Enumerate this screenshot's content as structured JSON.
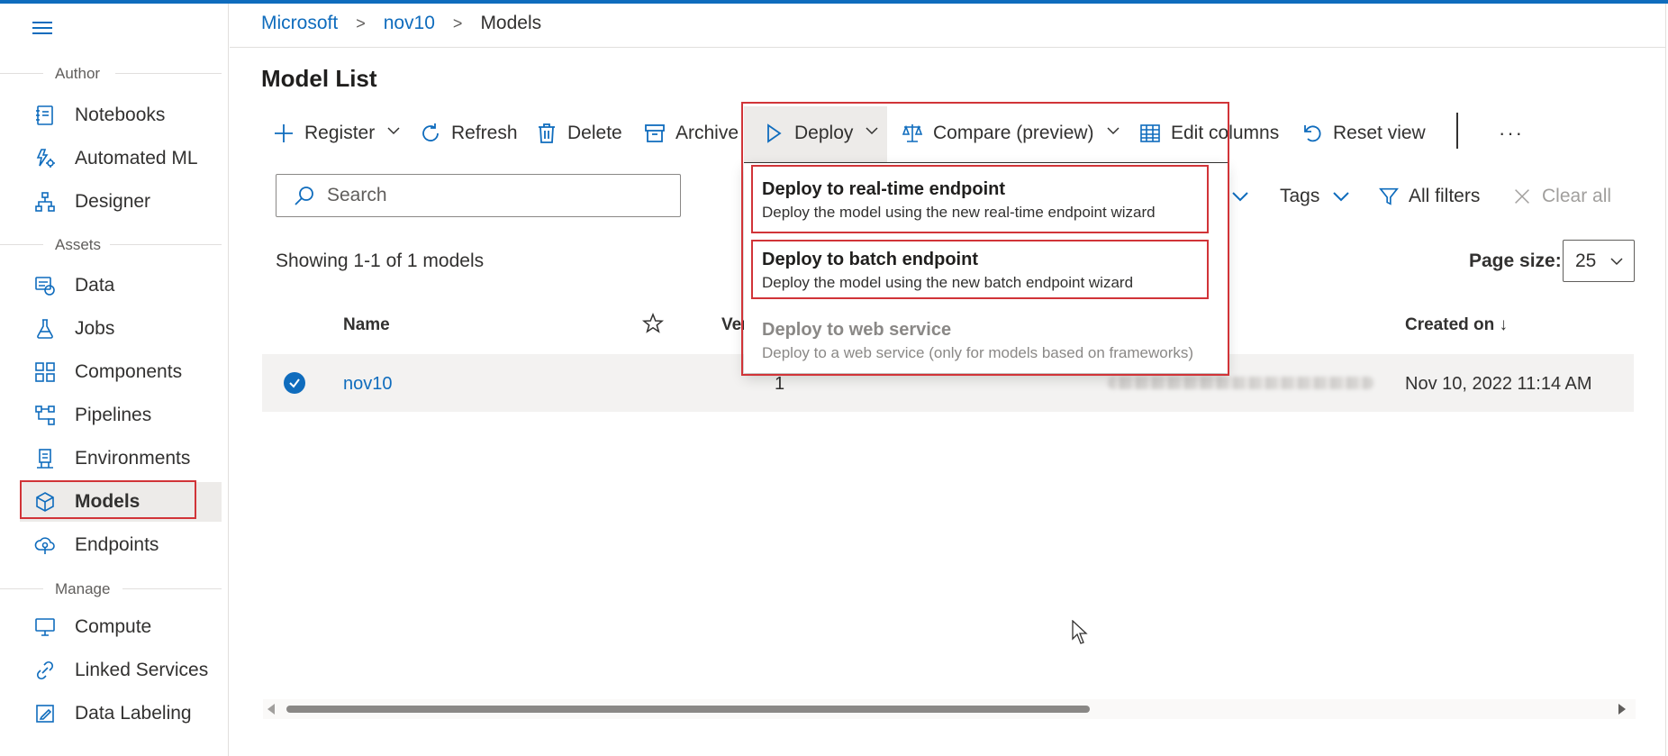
{
  "breadcrumb": {
    "root": "Microsoft",
    "workspace": "nov10",
    "current": "Models"
  },
  "page": {
    "title": "Model List"
  },
  "sidebar": {
    "sections": [
      {
        "label": "Author"
      },
      {
        "label": "Assets"
      },
      {
        "label": "Manage"
      }
    ],
    "items": [
      {
        "label": "Notebooks",
        "icon": "notebook-icon"
      },
      {
        "label": "Automated ML",
        "icon": "automated-ml-icon"
      },
      {
        "label": "Designer",
        "icon": "designer-icon"
      },
      {
        "label": "Data",
        "icon": "data-icon"
      },
      {
        "label": "Jobs",
        "icon": "flask-icon"
      },
      {
        "label": "Components",
        "icon": "components-icon"
      },
      {
        "label": "Pipelines",
        "icon": "pipelines-icon"
      },
      {
        "label": "Environments",
        "icon": "environments-icon"
      },
      {
        "label": "Models",
        "icon": "cube-icon",
        "selected": true
      },
      {
        "label": "Endpoints",
        "icon": "cloud-endpoint-icon"
      },
      {
        "label": "Compute",
        "icon": "monitor-icon"
      },
      {
        "label": "Linked Services",
        "icon": "link-icon"
      },
      {
        "label": "Data Labeling",
        "icon": "edit-icon"
      }
    ]
  },
  "toolbar": {
    "register": "Register",
    "refresh": "Refresh",
    "delete": "Delete",
    "archive": "Archive",
    "deploy": "Deploy",
    "compare": "Compare (preview)",
    "edit_columns": "Edit columns",
    "reset_view": "Reset view",
    "more": "···"
  },
  "search": {
    "placeholder": "Search"
  },
  "filters": {
    "tags": "Tags",
    "all_filters": "All filters",
    "clear_all": "Clear all"
  },
  "list": {
    "showing": "Showing 1-1 of 1 models",
    "page_size_label": "Page size:",
    "page_size_value": "25",
    "columns": {
      "name": "Name",
      "version": "Ver",
      "created_on": "Created on ↓"
    },
    "rows": [
      {
        "name": "nov10",
        "version": "1",
        "created_on": "Nov 10, 2022 11:14 AM",
        "selected": true
      }
    ]
  },
  "deploy_menu": {
    "items": [
      {
        "title": "Deploy to real-time endpoint",
        "desc": "Deploy the model using the new real-time endpoint wizard",
        "disabled": false
      },
      {
        "title": "Deploy to batch endpoint",
        "desc": "Deploy the model using the new batch endpoint wizard",
        "disabled": false
      },
      {
        "title": "Deploy to web service",
        "desc": "Deploy to a web service (only for models based on frameworks)",
        "disabled": true
      }
    ]
  },
  "colors": {
    "accent": "#0f6cbd",
    "highlight": "#d13438",
    "selected_bg": "#edebe9"
  }
}
